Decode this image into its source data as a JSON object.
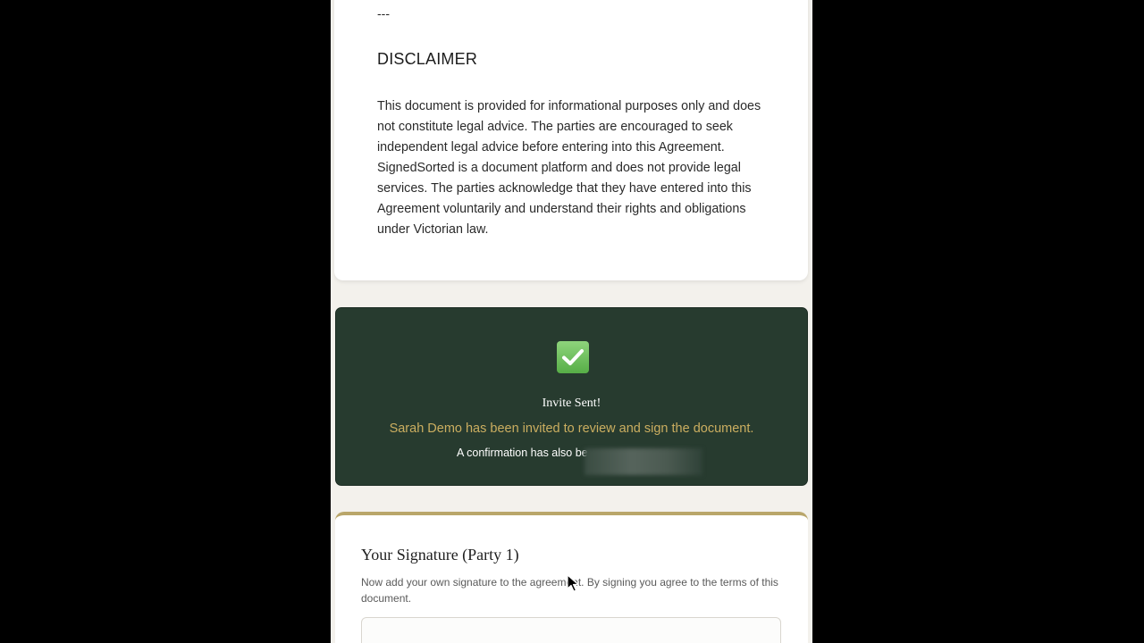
{
  "document": {
    "separator": "---",
    "disclaimer_heading": "DISCLAIMER",
    "disclaimer_text": "This document is provided for informational purposes only and does not constitute legal advice. The parties are encouraged to seek independent legal advice before entering into this Agreement. SignedSorted is a document platform and does not provide legal services. The parties acknowledge that they have entered into this Agreement voluntarily and understand their rights and obligations under Victorian law."
  },
  "invite": {
    "icon": "check-mark-icon",
    "title": "Invite Sent!",
    "message": "Sarah Demo has been invited to review and sign the document.",
    "confirmation": "A confirmation has also be"
  },
  "signature": {
    "title": "Your Signature (Party 1)",
    "description": "Now add your own signature to the agreement. By signing you agree to the terms of this document."
  },
  "colors": {
    "invite_background": "#273b2f",
    "invite_message": "#cbae60",
    "signature_accent": "#b9a66a",
    "page_background": "#f3f1ec"
  }
}
